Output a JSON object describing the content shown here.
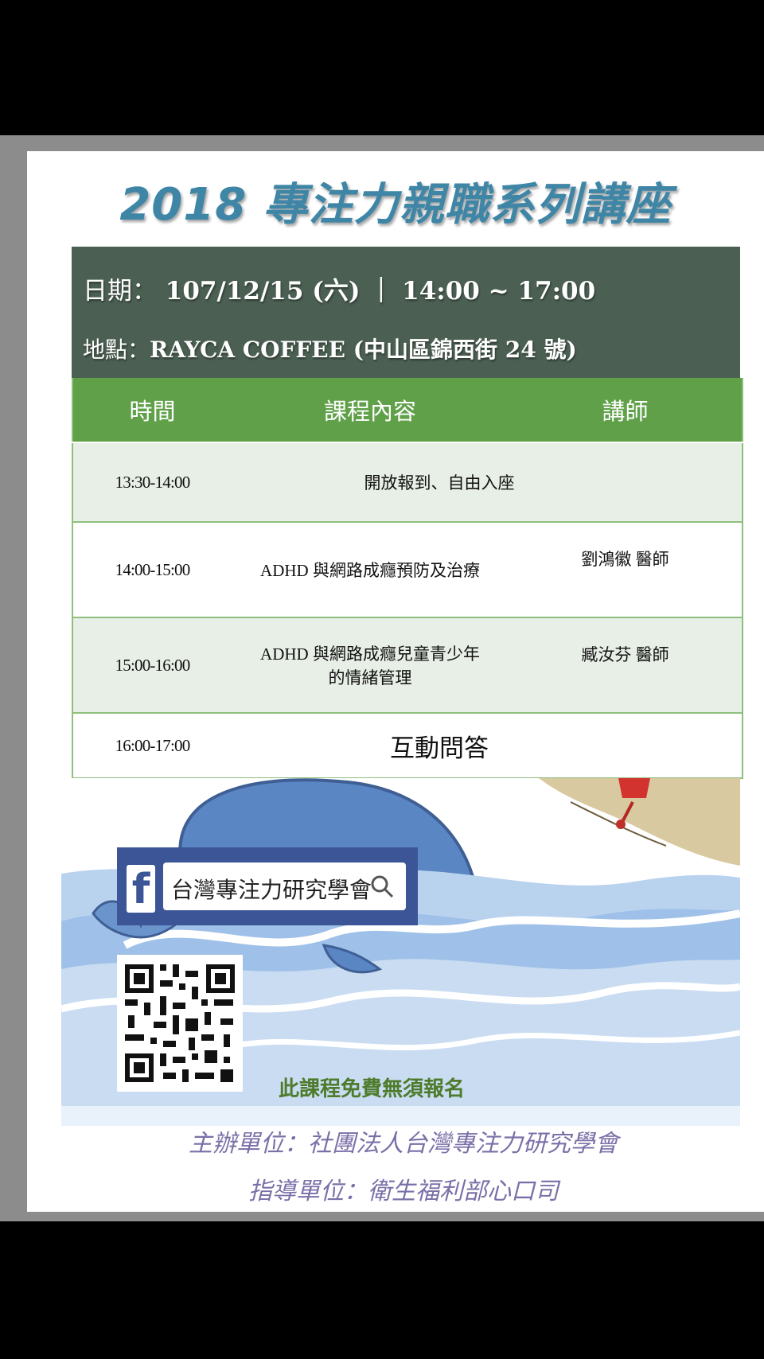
{
  "title": "2018 專注力親職系列講座",
  "info": {
    "date_label": "日期：",
    "date_value": "107/12/15 (六)",
    "separator": "｜",
    "time_value": "14:00 ~ 17:00",
    "place_label": "地點：",
    "place_value": "RAYCA COFFEE (中山區錦西街 24 號)"
  },
  "schedule": {
    "headers": [
      "時間",
      "課程內容",
      "講師"
    ],
    "rows": [
      {
        "time": "13:30-14:00",
        "content": "開放報到、自由入座",
        "speaker": ""
      },
      {
        "time": "14:00-15:00",
        "content": "ADHD 與網路成癮預防及治療",
        "speaker": "劉鴻徽 醫師"
      },
      {
        "time": "15:00-16:00",
        "content_line1": "ADHD 與網路成癮兒童青少年",
        "content_line2": "的情緒管理",
        "speaker": "臧汝芬 醫師"
      },
      {
        "time": "16:00-17:00",
        "content": "互動問答",
        "speaker": ""
      }
    ]
  },
  "facebook": {
    "logo_letter": "f",
    "search_text": "台灣專注力研究學會",
    "icon": "search-icon"
  },
  "free_note": "此課程免費無須報名",
  "organizers": {
    "host": "主辦單位：社團法人台灣專注力研究學會",
    "advisor": "指導單位：衛生福利部心口司"
  },
  "colors": {
    "title": "#3f86a6",
    "info_bg": "#4b5f52",
    "header_green": "#5fa048",
    "row_tint": "#e8efe6",
    "facebook_blue": "#3b5596",
    "free_text": "#4e7b2c",
    "organizer_text": "#7b6fa8"
  }
}
